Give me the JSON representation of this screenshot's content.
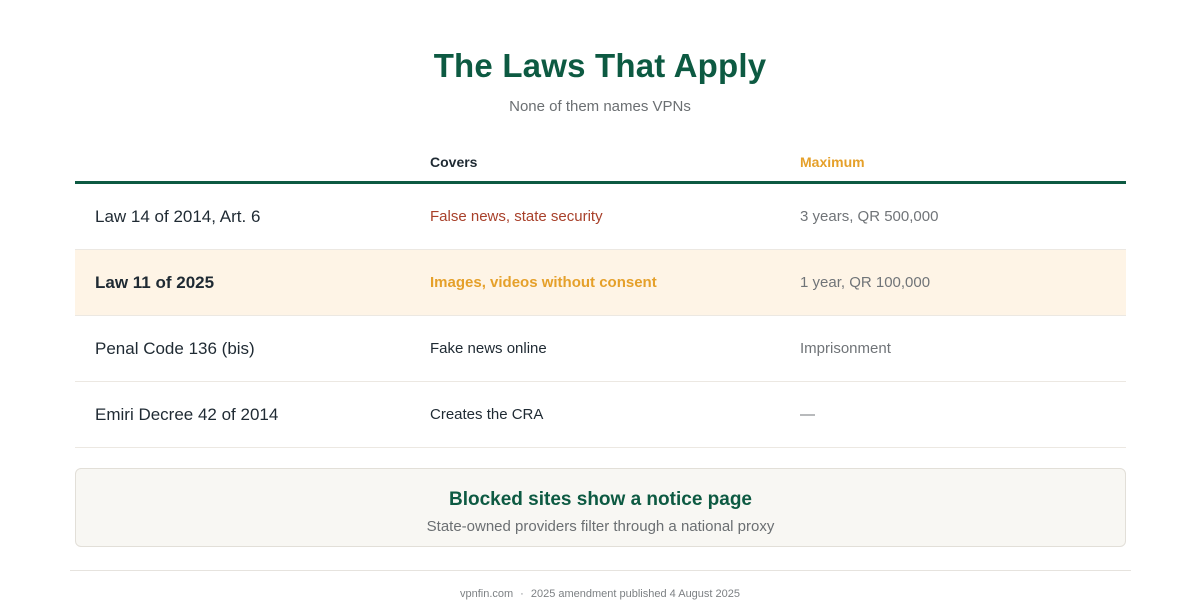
{
  "header": {
    "title": "The Laws That Apply",
    "subtitle": "None of them names VPNs"
  },
  "table": {
    "columns": {
      "law": "",
      "covers": "Covers",
      "maximum": "Maximum"
    },
    "rows": [
      {
        "law": "Law 14 of 2014, Art. 6",
        "covers": "False news, state security",
        "maximum": "3 years, QR 500,000"
      },
      {
        "law": "Law 11 of 2025",
        "covers": "Images, videos without consent",
        "maximum": "1 year, QR 100,000"
      },
      {
        "law": "Penal Code 136 (bis)",
        "covers": "Fake news online",
        "maximum": "Imprisonment"
      },
      {
        "law": "Emiri Decree 42 of 2014",
        "covers": "Creates the CRA",
        "maximum": "—"
      }
    ]
  },
  "notice": {
    "title": "Blocked sites show a notice page",
    "text": "State-owned providers filter through a national proxy"
  },
  "footer": {
    "site": "vpnfin.com",
    "separator": "·",
    "note": "2025 amendment published 4 August 2025"
  },
  "colors": {
    "brand_green": "#0d5a42",
    "accent_amber": "#e5a02a",
    "accent_red": "#a8402a",
    "highlight_row_bg": "#fef4e6"
  }
}
